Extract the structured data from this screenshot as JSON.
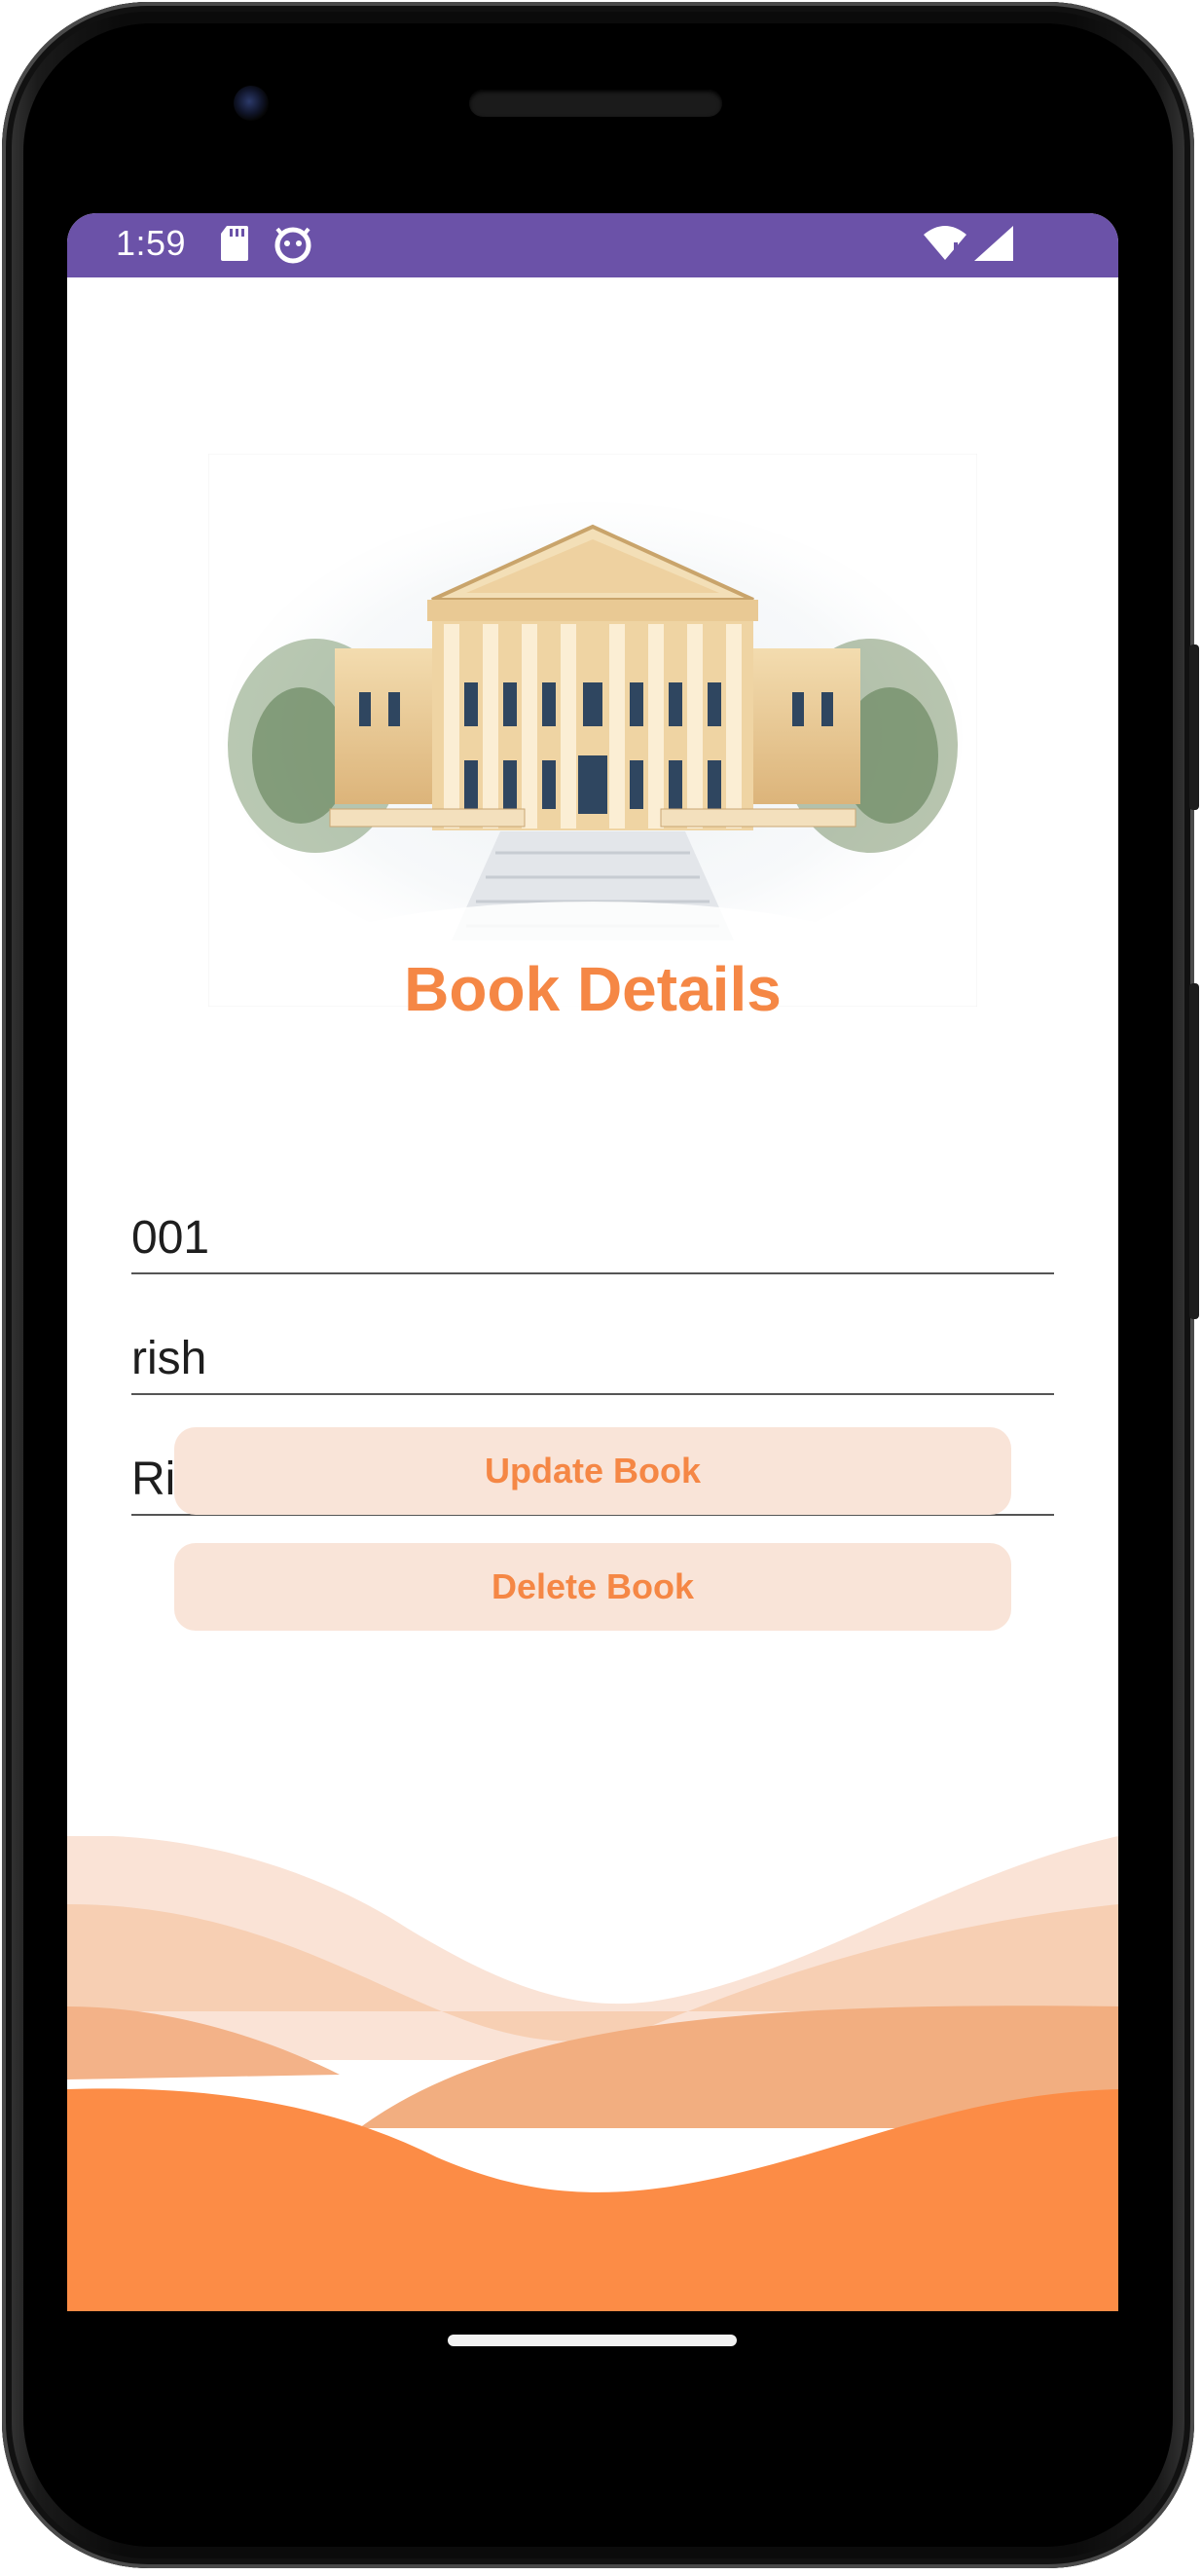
{
  "status_bar": {
    "time": "1:59",
    "icons": [
      "sd-card-icon",
      "bug-icon",
      "wifi-icon",
      "signal-icon"
    ],
    "color": "#6b52a8"
  },
  "header": {
    "title": "Book Details",
    "hero_image": "courthouse-watercolor-illustration"
  },
  "form": {
    "book_id": "001",
    "book_name": "rish",
    "book_author": "Risnvbbnb"
  },
  "actions": {
    "update_label": "Update Book",
    "delete_label": "Delete Book"
  },
  "colors": {
    "accent": "#f58745",
    "button_bg": "#f9e4d8",
    "wave_light": "#fae3d6",
    "wave_mid": "#f6c6a5",
    "wave_deep": "#f2ae80"
  }
}
